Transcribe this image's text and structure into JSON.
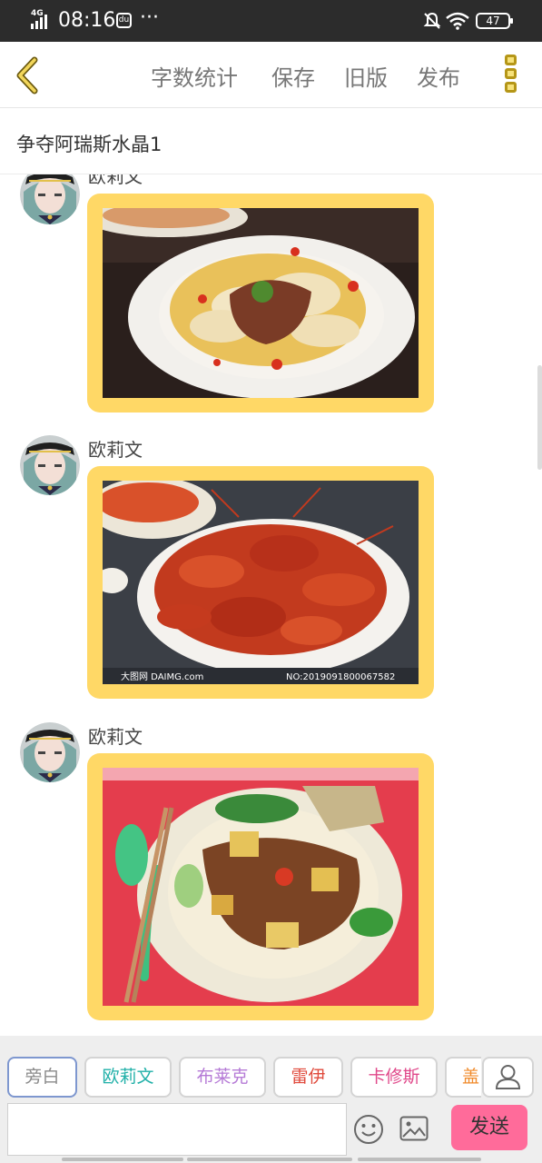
{
  "status_bar": {
    "network": "4G",
    "time": "08:16",
    "app_icon_text": "du",
    "more_indicator": "···",
    "battery": "47",
    "icons": [
      "signal-icon",
      "notification-app-icon",
      "bell-muted-icon",
      "wifi-icon",
      "battery-icon"
    ]
  },
  "toolbar": {
    "back_icon": "chevron-left-icon",
    "actions": [
      "字数统计",
      "保存",
      "旧版",
      "发布"
    ],
    "more_icon": "vertical-dots-menu-icon",
    "accent_color": "#ffd866"
  },
  "story": {
    "title": "争夺阿瑞斯水晶1"
  },
  "messages": [
    {
      "sender": "欧莉文",
      "image": "food-photo-dumplings-with-beef"
    },
    {
      "sender": "欧莉文",
      "image": "food-photo-crayfish",
      "watermark_left": "大图网 DAIMG.com",
      "watermark_right": "NO:20190918000675​82"
    },
    {
      "sender": "欧莉文",
      "image": "food-photo-chicken-noodles"
    }
  ],
  "roles": [
    {
      "label": "旁白",
      "color": "#8a8a8a"
    },
    {
      "label": "欧莉文",
      "color": "#20b0a8"
    },
    {
      "label": "布莱克",
      "color": "#b57ad6"
    },
    {
      "label": "雷伊",
      "color": "#e04a3c"
    },
    {
      "label": "卡修斯",
      "color": "#e0488a"
    },
    {
      "label": "盖",
      "color": "#f08a2a"
    }
  ],
  "composer": {
    "input_value": "",
    "emoji_icon": "smiley-icon",
    "image_icon": "image-icon",
    "send_label": "发送",
    "send_color": "#ff6b9a"
  }
}
